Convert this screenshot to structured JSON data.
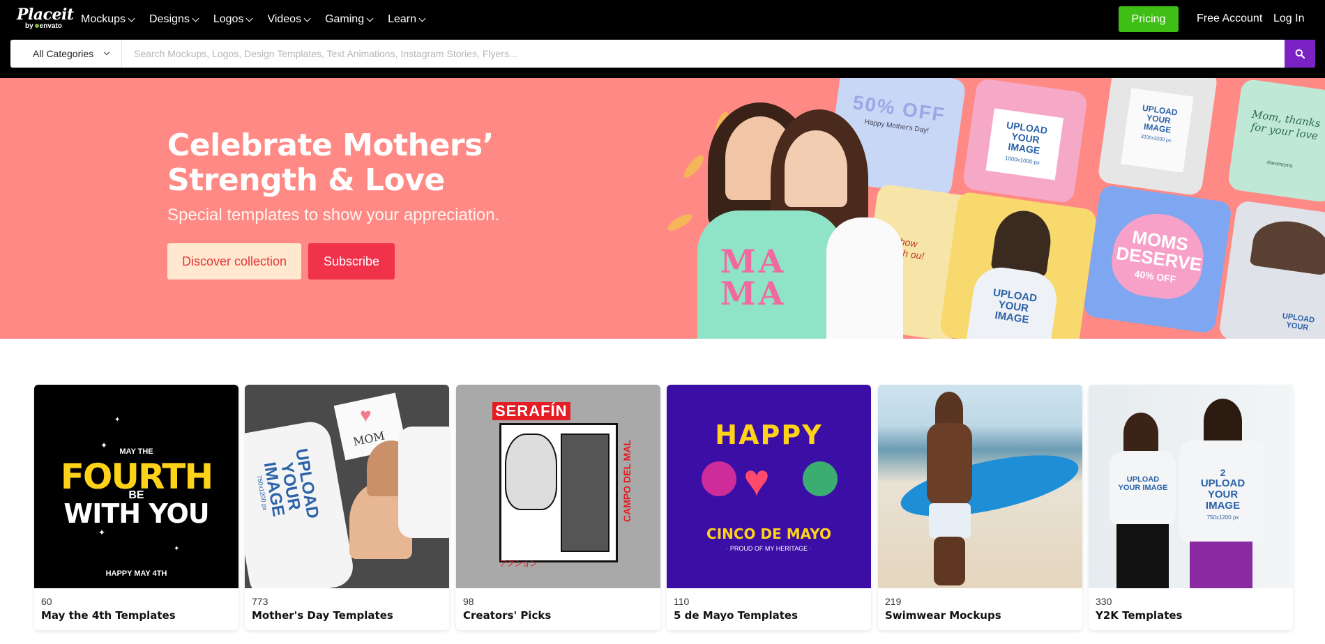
{
  "header": {
    "logo_brand": "Placeit",
    "logo_by": "by",
    "logo_envato": "envato",
    "menu": [
      {
        "label": "Mockups"
      },
      {
        "label": "Designs"
      },
      {
        "label": "Logos"
      },
      {
        "label": "Videos"
      },
      {
        "label": "Gaming"
      },
      {
        "label": "Learn"
      }
    ],
    "pricing_label": "Pricing",
    "free_account_label": "Free Account",
    "login_label": "Log In",
    "pricing_color": "#3fbf15"
  },
  "search": {
    "category_selected": "All Categories",
    "placeholder": "Search Mockups, Logos, Design Templates, Text Animations, Instagram Stories, Flyers...",
    "value": "",
    "button_icon": "search-icon",
    "button_color": "#7b22c4"
  },
  "hero": {
    "title": "Celebrate Mothers’ Strength & Love",
    "subtitle": "Special templates to show your appreciation.",
    "discover_label": "Discover collection",
    "subscribe_label": "Subscribe",
    "background_color": "#ff8a85",
    "art": {
      "tile_offer": "50% OFF",
      "tile_offer_sub": "Happy Mother's Day!",
      "tile_upload_1": "UPLOAD YOUR IMAGE",
      "tile_upload_1_sub": "1000x1000 px",
      "tile_upload_2": "UPLOAD YOUR IMAGE",
      "tile_upload_2_sub": "3200x3200 px",
      "tile_note": "Mom, thanks for your love",
      "tile_note_sub": "#tenmoms",
      "tile_moms": "MOMS DESERVE",
      "tile_moms_sub": "40% OFF",
      "tile_upload_3": "UPLOAD YOUR IMAGE",
      "tile_upload_4": "UPLOAD YOUR",
      "shirt_text": "MA MA",
      "tile_partial": "I how much ou!"
    }
  },
  "cards": [
    {
      "count": "60",
      "title": "May the 4th Templates",
      "art_top": "MAY THE",
      "art_main_1": "FOURTH",
      "art_mid": "BE",
      "art_main_2": "WITH YOU",
      "art_bottom": "HAPPY MAY 4TH"
    },
    {
      "count": "773",
      "title": "Mother's Day Templates",
      "art_note": "MOM",
      "art_shirt": "UPLOAD YOUR IMAGE",
      "art_shirt_size": "750x1200 px"
    },
    {
      "count": "98",
      "title": "Creators' Picks",
      "art_top": "SERAFÍN",
      "art_side": "CAMPO DEL MAL",
      "art_jp": "アクション"
    },
    {
      "count": "110",
      "title": "5 de Mayo Templates",
      "art_top": "HAPPY",
      "art_main": "CINCO DE MAYO",
      "art_bottom": "· PROUD OF MY HERITAGE ·"
    },
    {
      "count": "219",
      "title": "Swimwear Mockups"
    },
    {
      "count": "330",
      "title": "Y2K Templates",
      "art_shirt_1": "UPLOAD YOUR IMAGE",
      "art_shirt_2": "UPLOAD YOUR IMAGE",
      "art_shirt_2_num": "2",
      "art_shirt_2_size": "750x1200 px"
    }
  ]
}
